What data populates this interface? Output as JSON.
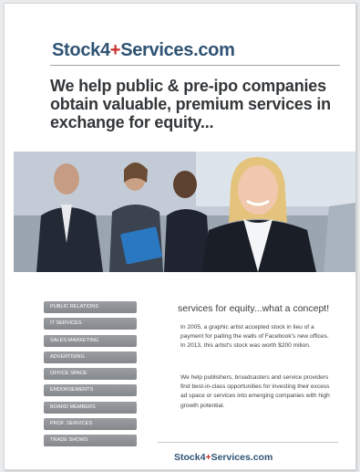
{
  "brand": {
    "logo_text_a": "Stock4",
    "logo_plus": "+",
    "logo_text_b": "Services.com",
    "primary_color": "#2f5373",
    "accent_color": "#c9302c"
  },
  "headline": "We help public & pre-ipo companies obtain valuable, premium services in exchange for equity...",
  "photo": {
    "icon": "business-team-photo"
  },
  "nav": {
    "items": [
      "PUBLIC RELATIONS",
      "IT SERVICES",
      "SALES-MARKETING",
      "ADVERTISING",
      "OFFICE SPACE",
      "ENDORSEMENTS",
      "BOARD MEMBERS",
      "PROF. SERVICES",
      "TRADE SHOWS"
    ]
  },
  "content": {
    "subhead": "services for equity...what a concept!",
    "paragraph_1": "In 2005, a graphic artist accepted stock in lieu of a payment for paiting the walls of Facebook's new offices. In 2013, this artist's stock was worth $200 milion.",
    "paragraph_2": "We help publishers, broadcasters and service providers find best-in-class opportunities for investing their excess ad space or services into emerging companies with high growth potential."
  },
  "footer": {
    "logo_text_a": "Stock4",
    "logo_plus": "+",
    "logo_text_b": "Services.com"
  }
}
